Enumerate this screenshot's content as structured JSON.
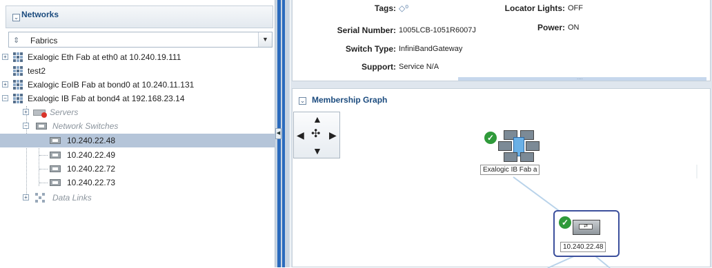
{
  "nav": {
    "title": "Networks",
    "select_value": "Fabrics",
    "tree": [
      {
        "label": "Exalogic Eth Fab at eth0 at 10.240.19.111"
      },
      {
        "label": "test2"
      },
      {
        "label": "Exalogic EoIB Fab at bond0 at 10.240.11.131"
      },
      {
        "label": "Exalogic IB Fab at bond4 at 192.168.23.14"
      },
      {
        "label": "Servers"
      },
      {
        "label": "Network Switches"
      },
      {
        "label": "10.240.22.48"
      },
      {
        "label": "10.240.22.49"
      },
      {
        "label": "10.240.22.72"
      },
      {
        "label": "10.240.22.73"
      },
      {
        "label": "Data Links"
      }
    ]
  },
  "details": {
    "tags_label": "Tags:",
    "serial_label": "Serial Number:",
    "serial_value": "1005LCB-1051R6007J",
    "switch_type_label": "Switch Type:",
    "switch_type_value": "InfiniBandGateway",
    "support_label": "Support:",
    "support_value": "Service N/A",
    "locator_label": "Locator Lights:",
    "locator_value": "OFF",
    "power_label": "Power:",
    "power_value": "ON"
  },
  "graph": {
    "title": "Membership Graph",
    "fabric_node_label": "Exalogic IB Fab a",
    "switch_node_label": "10.240.22.48"
  }
}
